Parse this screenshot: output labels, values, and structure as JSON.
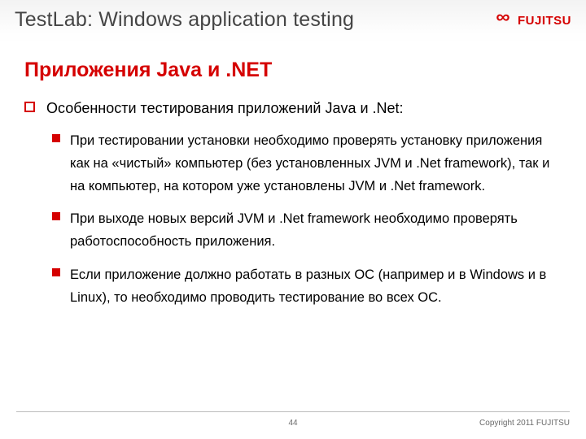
{
  "header": {
    "title": "TestLab: Windows application testing",
    "logo_text": "FUJITSU"
  },
  "slide": {
    "title": "Приложения Java и .NET",
    "lvl1": "Особенности тестирования приложений Java и .Net:",
    "lvl2": [
      "При тестировании установки необходимо проверять установку приложения как на «чистый» компьютер (без установленных JVM и .Net framework), так и на компьютер, на котором уже установлены JVM и .Net framework.",
      "При выходе новых версий JVM и .Net framework  необходимо проверять работоспособность приложения.",
      "Если приложение должно работать в разных ОС (например и в Windows и в Linux), то необходимо проводить тестирование во всех ОС."
    ]
  },
  "footer": {
    "page": "44",
    "copyright": "Copyright 2011 FUJITSU"
  }
}
